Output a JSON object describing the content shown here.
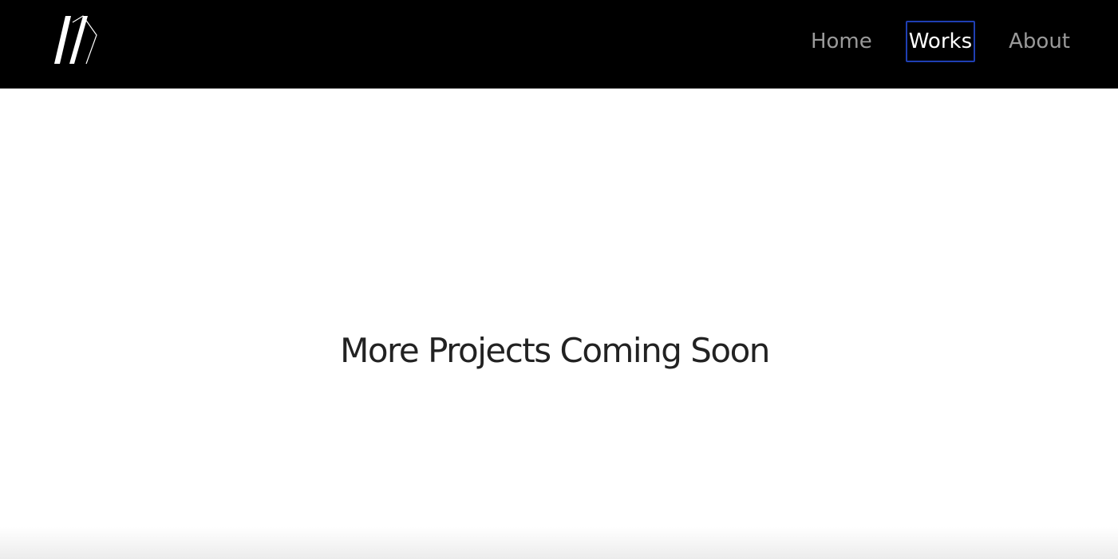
{
  "header": {
    "logo_icon": "m-monogram-logo-icon",
    "background": "#000000"
  },
  "nav": {
    "items": [
      {
        "label": "Home",
        "active": false
      },
      {
        "label": "Works",
        "active": true
      },
      {
        "label": "About",
        "active": false
      }
    ],
    "inactive_color": "#9a9a9a",
    "active_color": "#ffffff",
    "focus_outline_color": "#1f3fb3"
  },
  "main": {
    "headline": "More Projects Coming Soon",
    "text_color": "#222222"
  }
}
